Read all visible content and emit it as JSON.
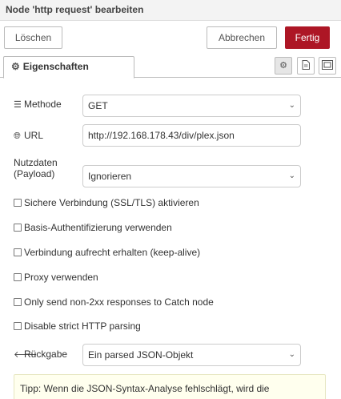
{
  "title": "Node 'http request' bearbeiten",
  "toolbar": {
    "delete_label": "Löschen",
    "cancel_label": "Abbrechen",
    "done_label": "Fertig"
  },
  "tabs": {
    "properties_label": "Eigenschaften"
  },
  "form": {
    "method": {
      "label": "Methode",
      "value": "GET"
    },
    "url": {
      "label": "URL",
      "value": "http://192.168.178.43/div/plex.json"
    },
    "payload": {
      "label_line1": "Nutzdaten",
      "label_line2": "(Payload)",
      "value": "Ignorieren"
    },
    "checkboxes": [
      {
        "label": "Sichere Verbindung (SSL/TLS) aktivieren",
        "checked": false
      },
      {
        "label": "Basis-Authentifizierung verwenden",
        "checked": false
      },
      {
        "label": "Verbindung aufrecht erhalten (keep-alive)",
        "checked": false
      },
      {
        "label": "Proxy verwenden",
        "checked": false
      },
      {
        "label": "Only send non-2xx responses to Catch node",
        "checked": false
      },
      {
        "label": "Disable strict HTTP parsing",
        "checked": false
      }
    ],
    "return": {
      "label": "Rückgabe",
      "value": "Ein parsed JSON-Objekt"
    },
    "tip": "Tipp: Wenn die JSON-Syntax-Analyse fehlschlägt, wird die abgerufene Zeichenfolge zurückgegeben wie sie ist."
  },
  "icons": {
    "gear": "gear-icon",
    "method": "list-icon",
    "url": "globe-icon",
    "return": "arrow-left-icon",
    "description": "file-icon",
    "appearance": "frame-icon",
    "chevron": "chevron-down-icon"
  }
}
